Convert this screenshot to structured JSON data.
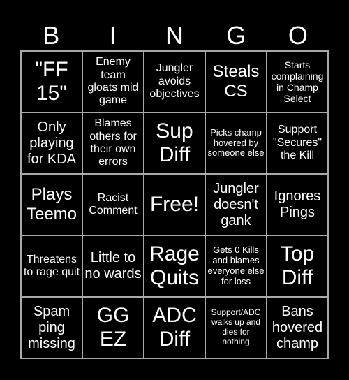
{
  "header": {
    "letters": [
      "B",
      "I",
      "N",
      "G",
      "O"
    ]
  },
  "cells": [
    "\"FF 15\"",
    "Enemy team gloats mid game",
    "Jungler avoids objectives",
    "Steals CS",
    "Starts complaining in Champ Select",
    "Only playing for KDA",
    "Blames others for their own errors",
    "Sup Diff",
    "Picks champ hovered by someone else",
    "Support \"Secures\" the Kill",
    "Plays Teemo",
    "Racist Comment",
    "Free!",
    "Jungler doesn't gank",
    "Ignores Pings",
    "Threatens to rage quit",
    "Little to no wards",
    "Rage Quits",
    "Gets 0 Kills and blames everyone else for loss",
    "Top Diff",
    "Spam ping missing",
    "GG EZ",
    "ADC Diff",
    "Support/ADC walks up and dies for nothing",
    "Bans hovered champ"
  ],
  "colors": {
    "background": "#000000",
    "text": "#ffffff",
    "grid_line": "#a8a8a8"
  }
}
